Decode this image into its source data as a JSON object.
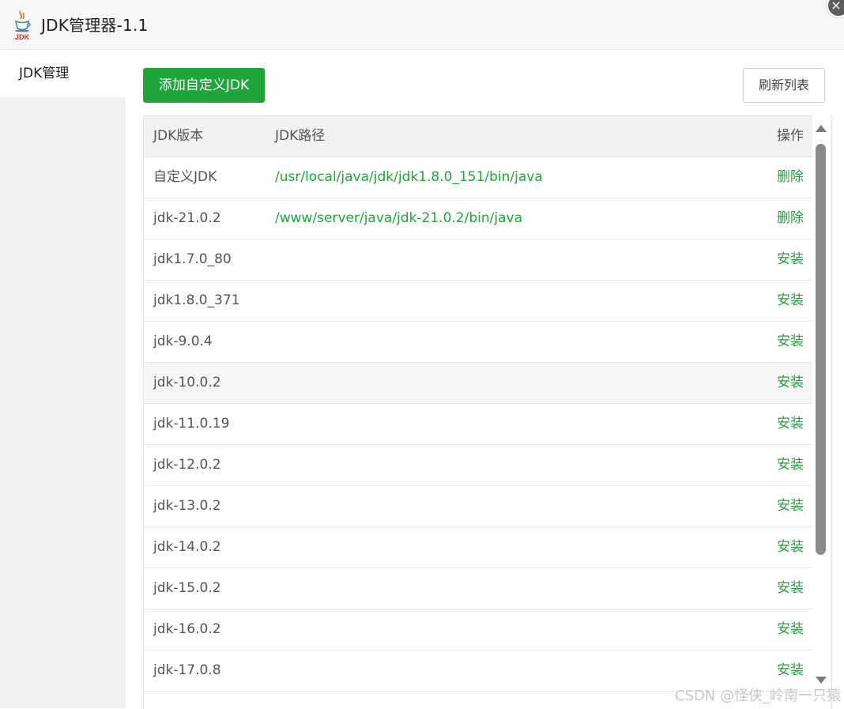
{
  "window": {
    "title": "JDK管理器-1.1",
    "logo_text": "JDK",
    "close_glyph": "×"
  },
  "sidebar": {
    "items": [
      {
        "label": "JDK管理",
        "active": true
      }
    ]
  },
  "toolbar": {
    "add_label": "添加自定义JDK",
    "refresh_label": "刷新列表"
  },
  "table": {
    "headers": {
      "version": "JDK版本",
      "path": "JDK路径",
      "action": "操作"
    },
    "rows": [
      {
        "version": "自定义JDK",
        "path": "/usr/local/java/jdk/jdk1.8.0_151/bin/java",
        "action": "删除"
      },
      {
        "version": "jdk-21.0.2",
        "path": "/www/server/java/jdk-21.0.2/bin/java",
        "action": "删除"
      },
      {
        "version": "jdk1.7.0_80",
        "path": "",
        "action": "安装"
      },
      {
        "version": "jdk1.8.0_371",
        "path": "",
        "action": "安装"
      },
      {
        "version": "jdk-9.0.4",
        "path": "",
        "action": "安装"
      },
      {
        "version": "jdk-10.0.2",
        "path": "",
        "action": "安装"
      },
      {
        "version": "jdk-11.0.19",
        "path": "",
        "action": "安装"
      },
      {
        "version": "jdk-12.0.2",
        "path": "",
        "action": "安装"
      },
      {
        "version": "jdk-13.0.2",
        "path": "",
        "action": "安装"
      },
      {
        "version": "jdk-14.0.2",
        "path": "",
        "action": "安装"
      },
      {
        "version": "jdk-15.0.2",
        "path": "",
        "action": "安装"
      },
      {
        "version": "jdk-16.0.2",
        "path": "",
        "action": "安装"
      },
      {
        "version": "jdk-17.0.8",
        "path": "",
        "action": "安装"
      }
    ]
  },
  "colors": {
    "accent_green": "#20a53a",
    "sidebar_bg": "#efefef",
    "header_bg": "#f2f2f2"
  },
  "watermark": "CSDN @怪侠_岭南一只猿"
}
